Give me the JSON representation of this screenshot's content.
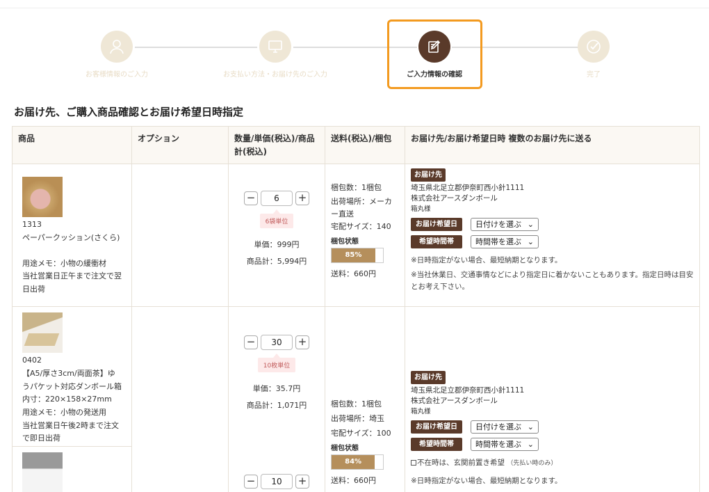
{
  "steps": [
    {
      "label": "お客様情報のご入力",
      "icon": "user-icon",
      "active": false
    },
    {
      "label": "お支払い方法・お届け先のご入力",
      "icon": "monitor-icon",
      "active": false
    },
    {
      "label": "ご入力情報の確認",
      "icon": "edit-icon",
      "active": true
    },
    {
      "label": "完了",
      "icon": "check-icon",
      "active": false
    }
  ],
  "section_title": "お届け先、ご購入商品確認とお届け希望日時指定",
  "table": {
    "headers": {
      "item": "商品",
      "option": "オプション",
      "qty": "数量/単価(税込)/商品計(税込)",
      "ship": "送料(税込)/梱包",
      "dest": "お届け先/お届け希望日時 複数のお届け先に送る"
    }
  },
  "items": [
    {
      "code": "1313",
      "name": "ペーパークッション(さくら)",
      "memo1": "用途メモ：小物の緩衝材",
      "memo2": "当社営業日正午まで注文で翌日出荷",
      "qty": "6",
      "unit": "6袋単位",
      "unit_price": "単価：999円",
      "subtotal": "商品計：5,994円"
    },
    {
      "code": "0402",
      "name": "【A5/厚さ3cm/両面茶】ゆうパケット対応ダンボール箱",
      "dims": "内寸：220×158×27mm",
      "memo1": "用途メモ：小物の発送用",
      "memo2": "当社営業日午後2時まで注文で即日出荷",
      "qty": "30",
      "unit": "10枚単位",
      "unit_price": "単価：35.7円",
      "subtotal": "商品計：1,071円"
    },
    {
      "qty": "10"
    }
  ],
  "shipments": [
    {
      "count": "梱包数：1梱包",
      "origin": "出荷場所：メーカー直送",
      "size": "宅配サイズ：140",
      "pack_title": "梱包状態",
      "pack_pct": 85,
      "pack_label": "85%",
      "fee": "送料：660円"
    },
    {
      "count": "梱包数：1梱包",
      "origin": "出荷場所：埼玉",
      "size": "宅配サイズ：100",
      "pack_title": "梱包状態",
      "pack_pct": 84,
      "pack_label": "84%",
      "fee": "送料：660円"
    }
  ],
  "destinations": [
    {
      "badge": "お届け先",
      "addr1": "埼玉県北足立郡伊奈町西小針1111",
      "addr2": "株式会社アースダンボール",
      "addr3": "箱丸様",
      "date_label": "お届け希望日",
      "date_select": "日付けを選ぶ",
      "time_label": "希望時間帯",
      "time_select": "時間帯を選ぶ",
      "note1": "※日時指定がない場合、最短納期となります。",
      "note2": "※当社休業日、交通事情などにより指定日に着かないこともあります。指定日時は目安とお考え下さい。"
    },
    {
      "badge": "お届け先",
      "addr1": "埼玉県北足立郡伊奈町西小針1111",
      "addr2": "株式会社アースダンボール",
      "addr3": "箱丸様",
      "date_label": "お届け希望日",
      "date_select": "日付けを選ぶ",
      "time_label": "希望時間帯",
      "time_select": "時間帯を選ぶ",
      "absent": "不在時は、玄関前置き希望",
      "absent_note": "（先払い時のみ）",
      "note1": "※日時指定がない場合、最短納期となります。"
    }
  ]
}
